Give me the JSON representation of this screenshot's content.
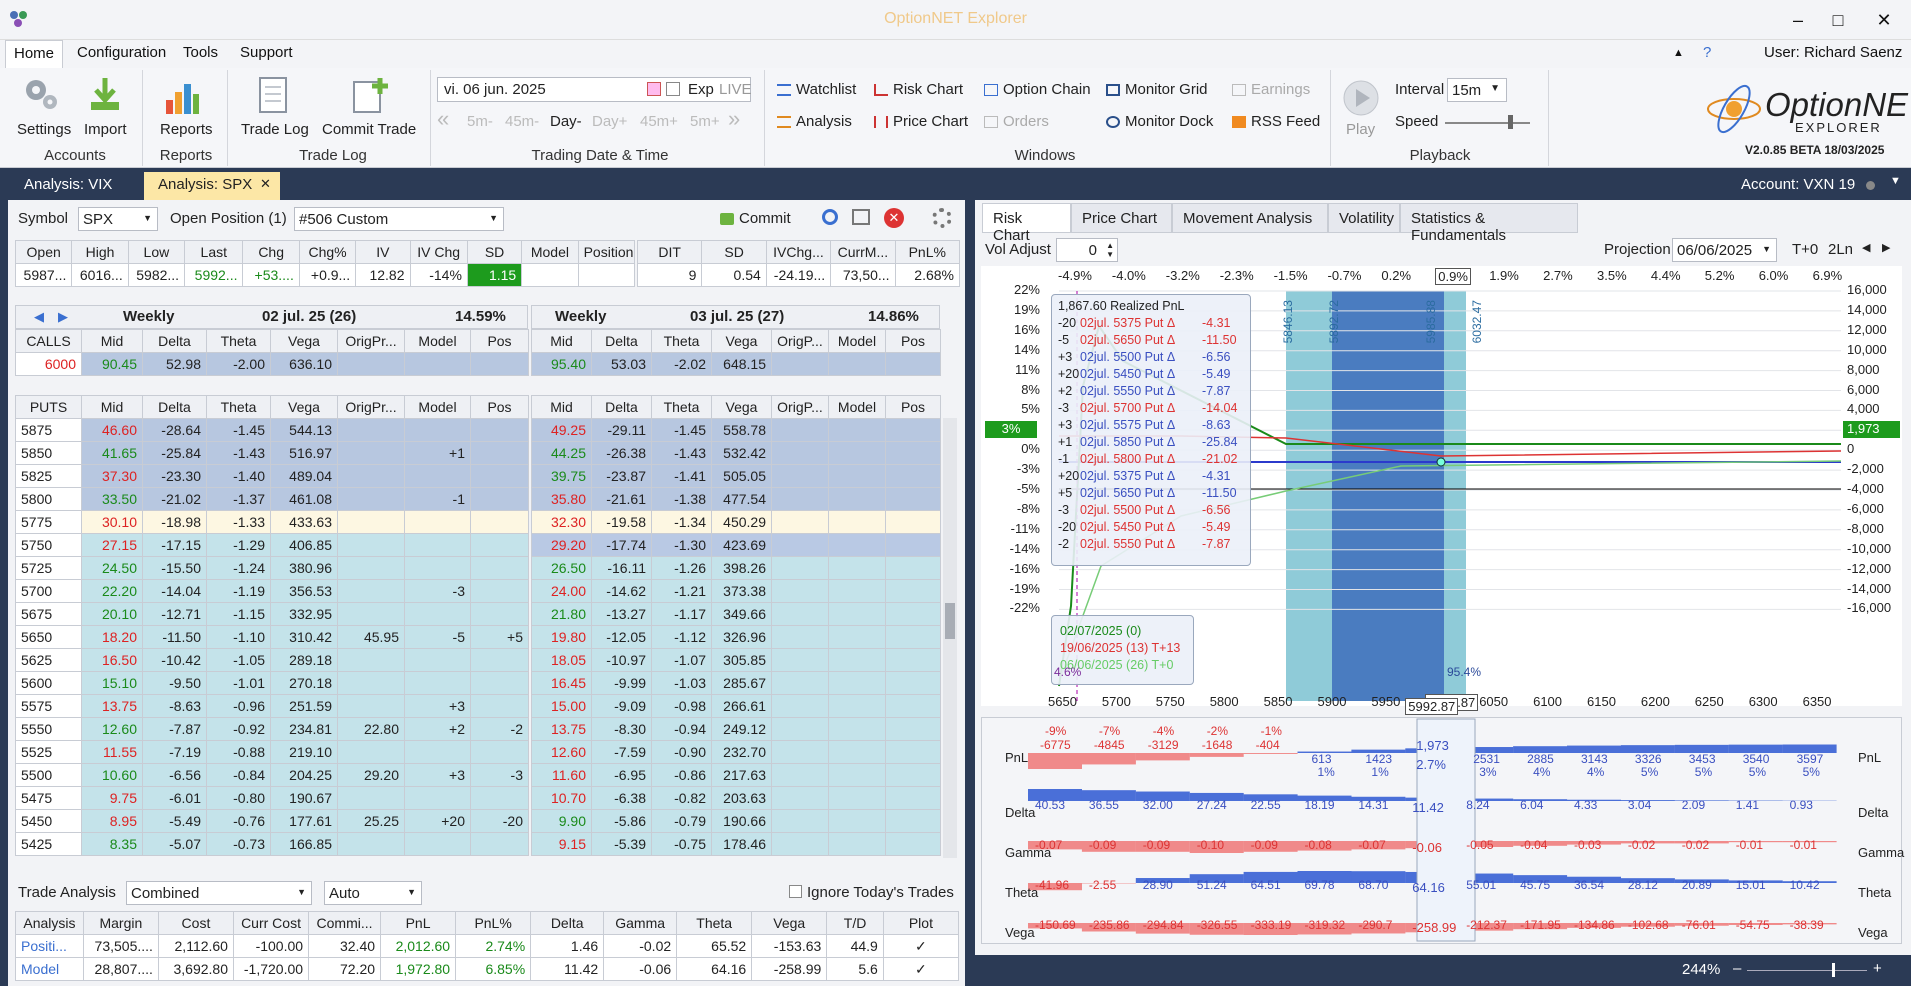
{
  "window": {
    "title": "OptionNET Explorer",
    "min": "–",
    "max": "□",
    "close": "✕"
  },
  "menu": {
    "items": [
      "Home",
      "Configuration",
      "Tools",
      "Support"
    ],
    "user": "User: Richard Saenz",
    "help": "?",
    "collapse": "▲"
  },
  "ribbon": {
    "settings": "Settings",
    "import": "Import",
    "accounts": "Accounts",
    "reports_btn": "Reports",
    "reports_grp": "Reports",
    "tradelog": "Trade Log",
    "commit": "Commit Trade",
    "tradelog_grp": "Trade Log",
    "date": "vi. 06 jun. 2025",
    "exp": "Exp",
    "live": "LIVE",
    "steps": [
      "5m-",
      "45m-",
      "Day-",
      "Day+",
      "45m+",
      "5m+"
    ],
    "date_grp": "Trading Date & Time",
    "win": {
      "watchlist": "Watchlist",
      "riskchart": "Risk Chart",
      "optionchain": "Option Chain",
      "monitorgrid": "Monitor Grid",
      "earnings": "Earnings",
      "analysis": "Analysis",
      "pricechart": "Price Chart",
      "orders": "Orders",
      "monitordock": "Monitor Dock",
      "rssfeed": "RSS Feed"
    },
    "windows_grp": "Windows",
    "play": "Play",
    "interval_lbl": "Interval",
    "interval": "15m",
    "speed": "Speed",
    "playback_grp": "Playback",
    "logo1": "OptionNET",
    "logo2": "EXPLORER",
    "version": "V2.0.85 BETA 18/03/2025"
  },
  "docbar": {
    "tab1": "Analysis: VIX",
    "tab2": "Analysis: SPX",
    "tab2_close": "✕",
    "account": "Account: VXN 19"
  },
  "left": {
    "symbol_lbl": "Symbol",
    "symbol": "SPX",
    "open_pos_lbl": "Open Position (1)",
    "position": "#506 Custom",
    "commit": "Commit",
    "quote_hdr": [
      "Open",
      "High",
      "Low",
      "Last",
      "Chg",
      "Chg%",
      "IV",
      "IV Chg",
      "SD",
      "Model",
      "Position"
    ],
    "quote_vals": [
      "5987...",
      "6016...",
      "5982...",
      "5992...",
      "+53....",
      "+0.9...",
      "12.82",
      "-14%",
      "1.15",
      "",
      ""
    ],
    "pos_hdr": [
      "DIT",
      "SD",
      "IVChg...",
      "CurrM...",
      "PnL%"
    ],
    "pos_vals": [
      "9",
      "0.54",
      "-24.19...",
      "73,50...",
      "2.68%"
    ],
    "exp1": {
      "name": "Weekly",
      "date": "02 jul. 25 (26)",
      "iv": "14.59%"
    },
    "exp2": {
      "name": "Weekly",
      "date": "03 jul. 25 (27)",
      "iv": "14.86%"
    },
    "col_hdr": [
      "Mid",
      "Delta",
      "Theta",
      "Vega",
      "OrigPr...",
      "Model",
      "Pos"
    ],
    "col_hdr2": [
      "Mid",
      "Delta",
      "Theta",
      "Vega",
      "OrigP...",
      "Model",
      "Pos"
    ],
    "calls_lbl": "CALLS",
    "puts_lbl": "PUTS",
    "call_row": {
      "strike": "6000",
      "c1": [
        "90.45",
        "52.98",
        "-2.00",
        "636.10",
        "",
        "",
        ""
      ],
      "c2": [
        "95.40",
        "53.03",
        "-2.02",
        "648.15",
        "",
        "",
        ""
      ]
    },
    "puts": [
      {
        "k": "5875",
        "a": [
          "46.60",
          "-28.64",
          "-1.45",
          "544.13",
          "",
          "",
          ""
        ],
        "b": [
          "49.25",
          "-29.11",
          "-1.45",
          "558.78",
          "",
          "",
          ""
        ],
        "mc": "red",
        "mc2": "red",
        "bg": "b"
      },
      {
        "k": "5850",
        "a": [
          "41.65",
          "-25.84",
          "-1.43",
          "516.97",
          "",
          "+1",
          ""
        ],
        "b": [
          "44.25",
          "-26.38",
          "-1.43",
          "532.42",
          "",
          "",
          ""
        ],
        "mc": "grn",
        "mc2": "grn",
        "bg": "b"
      },
      {
        "k": "5825",
        "a": [
          "37.30",
          "-23.30",
          "-1.40",
          "489.04",
          "",
          "",
          ""
        ],
        "b": [
          "39.75",
          "-23.87",
          "-1.41",
          "505.05",
          "",
          "",
          ""
        ],
        "mc": "red",
        "mc2": "grn",
        "bg": "b"
      },
      {
        "k": "5800",
        "a": [
          "33.50",
          "-21.02",
          "-1.37",
          "461.08",
          "",
          "-1",
          ""
        ],
        "b": [
          "35.80",
          "-21.61",
          "-1.38",
          "477.54",
          "",
          "",
          ""
        ],
        "mc": "grn",
        "mc2": "red",
        "bg": "b"
      },
      {
        "k": "5775",
        "a": [
          "30.10",
          "-18.98",
          "-1.33",
          "433.63",
          "",
          "",
          ""
        ],
        "b": [
          "32.30",
          "-19.58",
          "-1.34",
          "450.29",
          "",
          "",
          ""
        ],
        "mc": "red",
        "mc2": "red",
        "bg": "y"
      },
      {
        "k": "5750",
        "a": [
          "27.15",
          "-17.15",
          "-1.29",
          "406.85",
          "",
          "",
          ""
        ],
        "b": [
          "29.20",
          "-17.74",
          "-1.30",
          "423.69",
          "",
          "",
          ""
        ],
        "mc": "red",
        "mc2": "red",
        "bg": "l",
        "sel2": true
      },
      {
        "k": "5725",
        "a": [
          "24.50",
          "-15.50",
          "-1.24",
          "380.96",
          "",
          "",
          ""
        ],
        "b": [
          "26.50",
          "-16.11",
          "-1.26",
          "398.26",
          "",
          "",
          ""
        ],
        "mc": "grn",
        "mc2": "grn",
        "bg": "l"
      },
      {
        "k": "5700",
        "a": [
          "22.20",
          "-14.04",
          "-1.19",
          "356.53",
          "",
          "-3",
          ""
        ],
        "b": [
          "24.00",
          "-14.62",
          "-1.21",
          "373.38",
          "",
          "",
          ""
        ],
        "mc": "grn",
        "mc2": "red",
        "bg": "l"
      },
      {
        "k": "5675",
        "a": [
          "20.10",
          "-12.71",
          "-1.15",
          "332.95",
          "",
          "",
          ""
        ],
        "b": [
          "21.80",
          "-13.27",
          "-1.17",
          "349.66",
          "",
          "",
          ""
        ],
        "mc": "grn",
        "mc2": "grn",
        "bg": "l"
      },
      {
        "k": "5650",
        "a": [
          "18.20",
          "-11.50",
          "-1.10",
          "310.42",
          "45.95",
          "-5",
          "+5"
        ],
        "b": [
          "19.80",
          "-12.05",
          "-1.12",
          "326.96",
          "",
          "",
          ""
        ],
        "mc": "red",
        "mc2": "red",
        "bg": "l"
      },
      {
        "k": "5625",
        "a": [
          "16.50",
          "-10.42",
          "-1.05",
          "289.18",
          "",
          "",
          ""
        ],
        "b": [
          "18.05",
          "-10.97",
          "-1.07",
          "305.85",
          "",
          "",
          ""
        ],
        "mc": "red",
        "mc2": "red",
        "bg": "l"
      },
      {
        "k": "5600",
        "a": [
          "15.10",
          "-9.50",
          "-1.01",
          "270.18",
          "",
          "",
          ""
        ],
        "b": [
          "16.45",
          "-9.99",
          "-1.03",
          "285.67",
          "",
          "",
          ""
        ],
        "mc": "grn",
        "mc2": "red",
        "bg": "l"
      },
      {
        "k": "5575",
        "a": [
          "13.75",
          "-8.63",
          "-0.96",
          "251.59",
          "",
          "+3",
          ""
        ],
        "b": [
          "15.00",
          "-9.09",
          "-0.98",
          "266.61",
          "",
          "",
          ""
        ],
        "mc": "red",
        "mc2": "red",
        "bg": "l"
      },
      {
        "k": "5550",
        "a": [
          "12.60",
          "-7.87",
          "-0.92",
          "234.81",
          "22.80",
          "+2",
          "-2"
        ],
        "b": [
          "13.75",
          "-8.30",
          "-0.94",
          "249.12",
          "",
          "",
          ""
        ],
        "mc": "grn",
        "mc2": "red",
        "bg": "l"
      },
      {
        "k": "5525",
        "a": [
          "11.55",
          "-7.19",
          "-0.88",
          "219.10",
          "",
          "",
          ""
        ],
        "b": [
          "12.60",
          "-7.59",
          "-0.90",
          "232.70",
          "",
          "",
          ""
        ],
        "mc": "red",
        "mc2": "red",
        "bg": "l"
      },
      {
        "k": "5500",
        "a": [
          "10.60",
          "-6.56",
          "-0.84",
          "204.25",
          "29.20",
          "+3",
          "-3"
        ],
        "b": [
          "11.60",
          "-6.95",
          "-0.86",
          "217.63",
          "",
          "",
          ""
        ],
        "mc": "grn",
        "mc2": "red",
        "bg": "l"
      },
      {
        "k": "5475",
        "a": [
          "9.75",
          "-6.01",
          "-0.80",
          "190.67",
          "",
          "",
          ""
        ],
        "b": [
          "10.70",
          "-6.38",
          "-0.82",
          "203.63",
          "",
          "",
          ""
        ],
        "mc": "red",
        "mc2": "red",
        "bg": "l"
      },
      {
        "k": "5450",
        "a": [
          "8.95",
          "-5.49",
          "-0.76",
          "177.61",
          "25.25",
          "+20",
          "-20"
        ],
        "b": [
          "9.90",
          "-5.86",
          "-0.79",
          "190.66",
          "",
          "",
          ""
        ],
        "mc": "red",
        "mc2": "grn",
        "bg": "l"
      },
      {
        "k": "5425",
        "a": [
          "8.35",
          "-5.07",
          "-0.73",
          "166.85",
          "",
          "",
          ""
        ],
        "b": [
          "9.15",
          "-5.39",
          "-0.75",
          "178.46",
          "",
          "",
          ""
        ],
        "mc": "grn",
        "mc2": "red",
        "bg": "l"
      }
    ],
    "trade": {
      "lbl": "Trade Analysis",
      "mode": "Combined",
      "auto": "Auto",
      "ignore": "Ignore Today's Trades",
      "hdr": [
        "Analysis",
        "Margin",
        "Cost",
        "Curr Cost",
        "Commi...",
        "PnL",
        "PnL%",
        "Delta",
        "Gamma",
        "Theta",
        "Vega",
        "T/D",
        "Plot"
      ],
      "rows": [
        [
          "Positi...",
          "73,505....",
          "2,112.60",
          "-100.00",
          "32.40",
          "2,012.60",
          "2.74%",
          "1.46",
          "-0.02",
          "65.52",
          "-153.63",
          "44.9",
          "✓"
        ],
        [
          "Model",
          "28,807....",
          "3,692.80",
          "-1,720.00",
          "72.20",
          "1,972.80",
          "6.85%",
          "11.42",
          "-0.06",
          "64.16",
          "-258.99",
          "5.6",
          "✓"
        ]
      ]
    }
  },
  "right": {
    "tabs": [
      "Risk Chart",
      "Price Chart",
      "Movement Analysis",
      "Volatility",
      "Statistics & Fundamentals"
    ],
    "vol_adjust_lbl": "Vol Adjust",
    "vol_adjust": "0",
    "projection_lbl": "Projection",
    "projection": "06/06/2025",
    "t0": "T+0",
    "ln": "2Ln",
    "top_pct": [
      "-4.9%",
      "-4.0%",
      "-3.2%",
      "-2.3%",
      "-1.5%",
      "-0.7%",
      "0.2%",
      "0.9%",
      "1.9%",
      "2.7%",
      "3.5%",
      "4.4%",
      "5.2%",
      "6.0%",
      "6.9%"
    ],
    "left_pct": [
      "22%",
      "19%",
      "16%",
      "14%",
      "11%",
      "8%",
      "5%",
      "3%",
      "0%",
      "-3%",
      "-5%",
      "-8%",
      "-11%",
      "-14%",
      "-16%",
      "-19%",
      "-22%"
    ],
    "right_vals": [
      "16,000",
      "14,000",
      "12,000",
      "10,000",
      "8,000",
      "6,000",
      "4,000",
      "1,973",
      "0",
      "-2,000",
      "-4,000",
      "-6,000",
      "-8,000",
      "-10,000",
      "-12,000",
      "-14,000",
      "-16,000"
    ],
    "x_vals": [
      "5650",
      "5700",
      "5750",
      "5800",
      "5850",
      "5900",
      "5950",
      "5992.87",
      "6050",
      "6100",
      "6150",
      "6200",
      "6250",
      "6300",
      "6350"
    ],
    "band_lbls": [
      "5846.13",
      "5892.72",
      "5985.88",
      "6032.47"
    ],
    "tip_title": "1,867.60 Realized PnL",
    "tip_rows": [
      [
        "-20",
        "02jul. 5375 Put Δ",
        "-4.31",
        "r"
      ],
      [
        "-5",
        "02jul. 5650 Put Δ",
        "-11.50",
        "r"
      ],
      [
        "+3",
        "02jul. 5500 Put Δ",
        "-6.56",
        "b"
      ],
      [
        "+20",
        "02jul. 5450 Put Δ",
        "-5.49",
        "b"
      ],
      [
        "+2",
        "02jul. 5550 Put Δ",
        "-7.87",
        "b"
      ],
      [
        "-3",
        "02jul. 5700 Put Δ",
        "-14.04",
        "r"
      ],
      [
        "+3",
        "02jul. 5575 Put Δ",
        "-8.63",
        "b"
      ],
      [
        "+1",
        "02jul. 5850 Put Δ",
        "-25.84",
        "b"
      ],
      [
        "-1",
        "02jul. 5800 Put Δ",
        "-21.02",
        "r"
      ],
      [
        "+20",
        "02jul. 5375 Put Δ",
        "-4.31",
        "b"
      ],
      [
        "+5",
        "02jul. 5650 Put Δ",
        "-11.50",
        "b"
      ],
      [
        "-3",
        "02jul. 5500 Put Δ",
        "-6.56",
        "r"
      ],
      [
        "-20",
        "02jul. 5450 Put Δ",
        "-5.49",
        "r"
      ],
      [
        "-2",
        "02jul. 5550 Put Δ",
        "-7.87",
        "r"
      ]
    ],
    "legend": [
      "02/07/2025 (0)",
      "19/06/2025 (13) T+13",
      "06/06/2025 (26) T+0"
    ],
    "left_pct_box": "4.6%",
    "right_pct_box": "95.4%",
    "cur_pct": "3%",
    "cur_val": "1,973",
    "greeks": {
      "labels": [
        "PnL",
        "Delta",
        "Gamma",
        "Theta",
        "Vega"
      ],
      "pnl_top": [
        "-9%",
        "-7%",
        "-4%",
        "-2%",
        "-1%"
      ],
      "pnl_neg": [
        "-6775",
        "-4845",
        "-3129",
        "-1648",
        "-404"
      ],
      "pnl_pos": [
        "613",
        "1423",
        "",
        "2531",
        "2885",
        "3143",
        "3326",
        "3453",
        "3540",
        "3597"
      ],
      "pnl_pospct": [
        "1%",
        "1%",
        "",
        "3%",
        "4%",
        "4%",
        "5%",
        "5%",
        "5%",
        "5%"
      ],
      "center_pnl": "1,973",
      "center_pct": "2.7%",
      "delta": [
        "40.53",
        "36.55",
        "32.00",
        "27.24",
        "22.55",
        "18.19",
        "14.31",
        "11.42",
        "8.24",
        "6.04",
        "4.33",
        "3.04",
        "2.09",
        "1.41",
        "0.93"
      ],
      "gamma": [
        "-0.07",
        "-0.09",
        "-0.09",
        "-0.10",
        "-0.09",
        "-0.08",
        "-0.07",
        "-0.06",
        "-0.05",
        "-0.04",
        "-0.03",
        "-0.02",
        "-0.02",
        "-0.01",
        "-0.01"
      ],
      "theta": [
        "-41.96",
        "-2.55",
        "28.90",
        "51.24",
        "64.51",
        "69.78",
        "68.70",
        "64.16",
        "55.01",
        "45.75",
        "36.54",
        "28.12",
        "20.89",
        "15.01",
        "10.42"
      ],
      "vega": [
        "-150.69",
        "-235.86",
        "-294.84",
        "-326.55",
        "-333.19",
        "-319.32",
        "-290.7",
        "-258.99",
        "-212.37",
        "-171.95",
        "-134.86",
        "-102.68",
        "-76.01",
        "-54.75",
        "-38.39"
      ]
    },
    "zoom": "244%",
    "zoom_minus": "–",
    "zoom_plus": "+"
  },
  "colors": {
    "accent": "#2b3a55",
    "green_box": "#1d9b1d",
    "blue_band": "#4a7cc0",
    "light_band": "#8fcbd8"
  }
}
